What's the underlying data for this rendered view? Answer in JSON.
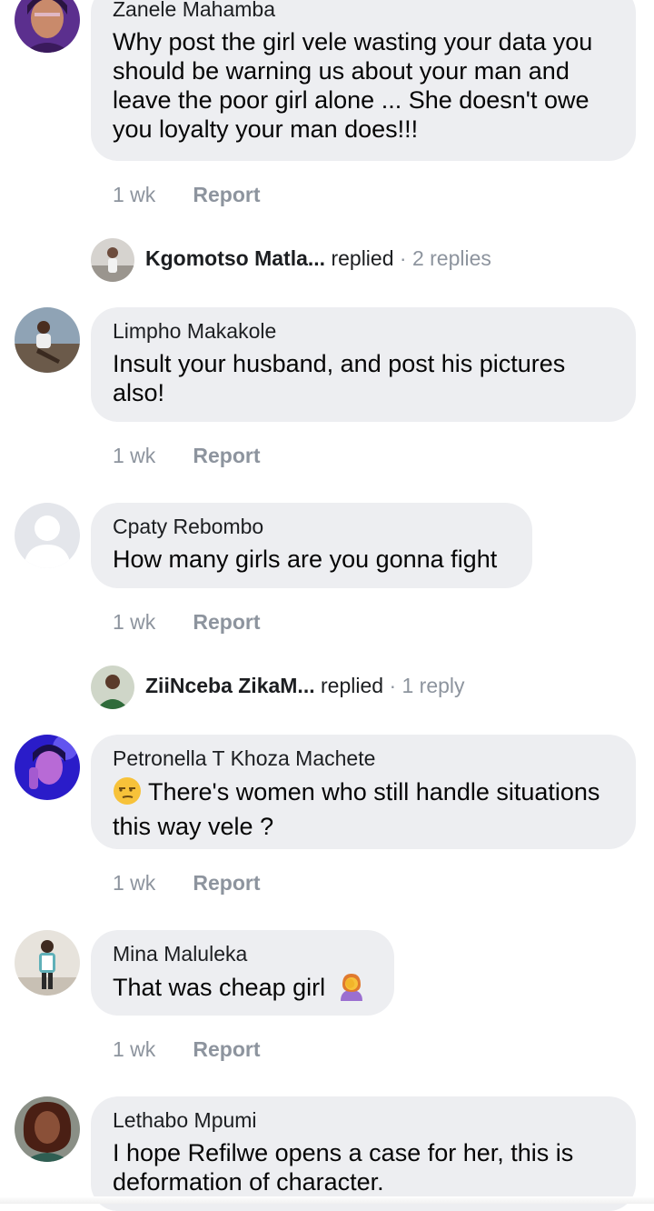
{
  "comments": [
    {
      "author": "Zanele Mahamba",
      "text": "Why post the girl vele wasting your data you should be warning us about your man and leave the poor girl alone ... She doesn't owe you loyalty your man does!!!",
      "time": "1 wk",
      "report": "Report",
      "avatar": "woman-avatar-purple"
    },
    {
      "author": "Limpho Makakole",
      "text": "Insult your husband, and post his pictures also!",
      "time": "1 wk",
      "report": "Report",
      "avatar": "woman-seated-avatar"
    },
    {
      "author": "Cpaty Rebombo",
      "text": "How many girls are you gonna fight",
      "time": "1 wk",
      "report": "Report",
      "avatar": "default-profile-icon"
    },
    {
      "author": "Petronella T Khoza Machete",
      "text": "There's women who still handle situations this way vele ?",
      "emoji": "unamused-face-emoji",
      "time": "1 wk",
      "report": "Report",
      "avatar": "woman-avatar-blue-light"
    },
    {
      "author": "Mina Maluleka",
      "text": "That was cheap girl",
      "emoji": "woman-facepalming-emoji",
      "time": "1 wk",
      "report": "Report",
      "avatar": "woman-standing-avatar"
    },
    {
      "author": "Lethabo Mpumi",
      "text": "I hope Refilwe opens a case for her, this is deformation of character.",
      "avatar": "woman-portrait-avatar"
    }
  ],
  "replies": [
    {
      "name": "Kgomotso Matla...",
      "action": "replied",
      "separator": "·",
      "count": "2 replies"
    },
    {
      "name": "ZiiNceba ZikaM...",
      "action": "replied",
      "separator": "·",
      "count": "1 reply"
    }
  ],
  "colors": {
    "bubble": "#edeef1",
    "meta": "#8d949e",
    "text": "#050505"
  }
}
